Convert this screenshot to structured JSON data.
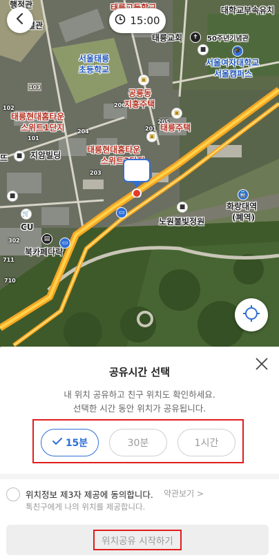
{
  "header": {
    "time": "15:00"
  },
  "map": {
    "labels": {
      "top_left": "행정관",
      "top_left2": "별관",
      "top_center": "태릉고등학교",
      "top_right": "대학교부속유치",
      "seoul_taereung": "서울태릉",
      "elementary": "초등학교",
      "taereung_church": "태릉교회",
      "gate_50": "50주년기념관",
      "women_univ": "서울여자대학교",
      "campus": "서울캠퍼스",
      "gongneung": "공릉동",
      "jihyang": "지흥주택",
      "hyundai_town": "태릉현대홈타운",
      "suite_1": "스위트1단지",
      "taereung_house": "태릉주택",
      "jiam": "지암빌딩",
      "hyundai_town2": "태릉현대홈타운",
      "suite_2": "스위트2단지",
      "hwarangdae": "화랑대역",
      "closed": "(폐역)",
      "noweon_park": "노원불빛정원",
      "cu": "CU",
      "bookcafe": "북카페다락",
      "ttt": "뜨",
      "num_103": "103",
      "num_102": "102",
      "num_101": "101",
      "num_206": "206",
      "num_204": "204",
      "num_205": "205",
      "num_201": "201",
      "num_203": "203",
      "num_302": "302",
      "num_711": "711",
      "num_710": "710"
    },
    "icons": {
      "back": "chevron-left-icon",
      "clock": "clock-icon",
      "locate": "crosshair-icon"
    }
  },
  "sheet": {
    "title": "공유시간 선택",
    "desc_line1": "내 위치 공유하고 친구 위치도 확인하세요.",
    "desc_line2": "선택한 시간 동안 위치가 공유됩니다.",
    "options": [
      {
        "label": "15분",
        "selected": true
      },
      {
        "label": "30분",
        "selected": false
      },
      {
        "label": "1시간",
        "selected": false
      }
    ],
    "agree_title": "위치정보 제3자 제공에 동의합니다.",
    "terms_link": "약관보기 >",
    "agree_sub": "톡친구에게 나의 위치를 제공합니다.",
    "start_button": "위치공유 시작하기"
  },
  "colors": {
    "accent": "#2f6fd6",
    "highlight_box": "#e21b1b",
    "route": "#f5a623"
  }
}
